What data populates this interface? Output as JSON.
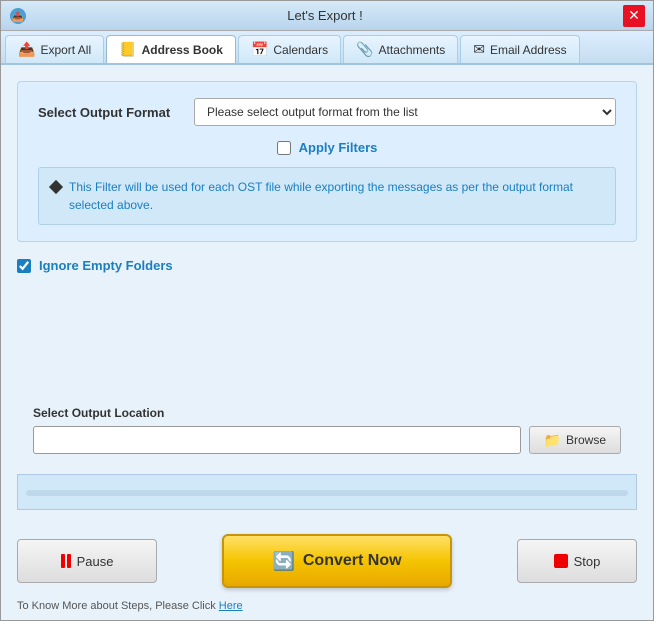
{
  "window": {
    "title": "Let's Export !",
    "close_label": "✕"
  },
  "tabs": [
    {
      "id": "export-all",
      "label": "Export All",
      "icon": "📤",
      "active": false
    },
    {
      "id": "address-book",
      "label": "Address Book",
      "icon": "📒",
      "active": true
    },
    {
      "id": "calendars",
      "label": "Calendars",
      "icon": "📅",
      "active": false
    },
    {
      "id": "attachments",
      "label": "Attachments",
      "icon": "📎",
      "active": false
    },
    {
      "id": "email-address",
      "label": "Email Address",
      "icon": "✉",
      "active": false
    }
  ],
  "format_section": {
    "select_label": "Select Output Format",
    "select_placeholder": "Please select output format from the list",
    "apply_filters_label": "Apply Filters",
    "filter_info": "This Filter will be used for each OST file while exporting the messages as per the output format selected above."
  },
  "ignore_folders": {
    "label": "Ignore Empty Folders",
    "checked": true
  },
  "output_location": {
    "label": "Select Output Location",
    "placeholder": "",
    "browse_label": "Browse"
  },
  "buttons": {
    "pause_label": "Pause",
    "convert_label": "Convert Now",
    "stop_label": "Stop"
  },
  "footer": {
    "text": "To Know More about Steps, Please Click ",
    "link_label": "Here"
  }
}
